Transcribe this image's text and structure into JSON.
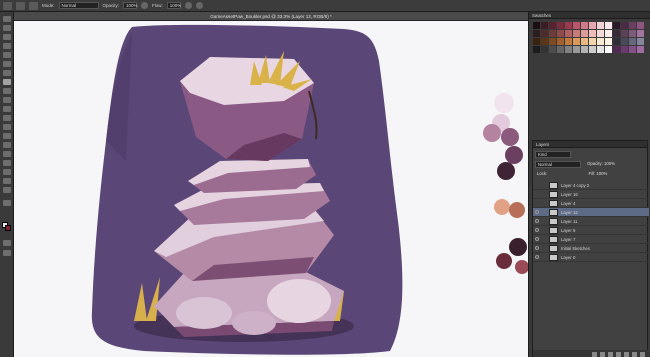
{
  "options_bar": {
    "mode_label": "Mode:",
    "mode_value": "Normal",
    "opacity_label": "Opacity:",
    "opacity_value": "100%",
    "flow_label": "Flow:",
    "flow_value": "100%"
  },
  "document_tab": {
    "title": "GameAssetPaw_Boulder.psd @ 33.3% (Layer 12, RGB/8) *"
  },
  "swatches_panel": {
    "title": "Swatches",
    "colors": [
      "#1a0f12",
      "#3b1b24",
      "#5a2130",
      "#7a2b3e",
      "#9b3a4f",
      "#b9546a",
      "#d27a8c",
      "#e8a6b3",
      "#f3cfd6",
      "#fbe8ec",
      "#2a1a28",
      "#4a2b44",
      "#6b3e61",
      "#8e567f",
      "#2b1d1d",
      "#4d2b2b",
      "#6e3b3b",
      "#8f4b4b",
      "#b06060",
      "#c87a7a",
      "#dd9c9c",
      "#eebcbc",
      "#f6d9d9",
      "#fff0f0",
      "#382a36",
      "#5b4258",
      "#7e5a7b",
      "#a1739e",
      "#3a2210",
      "#5c3619",
      "#7e4a22",
      "#a0602d",
      "#c07a3e",
      "#d89a5a",
      "#e8b984",
      "#f3d5ad",
      "#f9ead4",
      "#fff6e8",
      "#2f2f3a",
      "#4a4a5b",
      "#66667c",
      "#84849d",
      "#1c1c1c",
      "#333333",
      "#4d4d4d",
      "#666666",
      "#808080",
      "#999999",
      "#b3b3b3",
      "#cccccc",
      "#e6e6e6",
      "#ffffff",
      "#502a55",
      "#6a3a70",
      "#85508a",
      "#a06aa5"
    ]
  },
  "layers_panel": {
    "title": "Layers",
    "kind_label": "Kind",
    "blend_mode": "Normal",
    "opacity_label": "Opacity:",
    "opacity_value": "100%",
    "lock_label": "Lock:",
    "fill_label": "Fill:",
    "fill_value": "100%",
    "layers": [
      {
        "name": "Layer 4 copy 2",
        "visible": false,
        "selected": false
      },
      {
        "name": "Layer 16",
        "visible": false,
        "selected": false
      },
      {
        "name": "Layer 4",
        "visible": false,
        "selected": false
      },
      {
        "name": "Layer 12",
        "visible": true,
        "selected": true
      },
      {
        "name": "Layer 11",
        "visible": true,
        "selected": false
      },
      {
        "name": "Layer 9",
        "visible": true,
        "selected": false
      },
      {
        "name": "Layer 7",
        "visible": true,
        "selected": false
      },
      {
        "name": "Initial Sketches",
        "visible": true,
        "selected": false
      },
      {
        "name": "Layer 0",
        "visible": true,
        "selected": false
      }
    ]
  },
  "icons": {
    "brush": "brush-icon",
    "eye": "eye-icon",
    "link": "link-layers-icon",
    "fx": "fx-icon",
    "mask": "mask-icon",
    "adjust": "adjustment-icon",
    "group": "folder-icon",
    "new_layer": "new-layer-icon",
    "trash": "trash-icon"
  },
  "colors": {
    "canvas_bg": "#f6f6f8",
    "purple_bg": "#5a4778",
    "rock_light": "#e4d2e0",
    "rock_mid": "#b58aa8",
    "rock_dark": "#6f3f66",
    "grass": "#d7b04c",
    "ui_panel": "#3a3a3a",
    "selection": "#5d6b86"
  }
}
